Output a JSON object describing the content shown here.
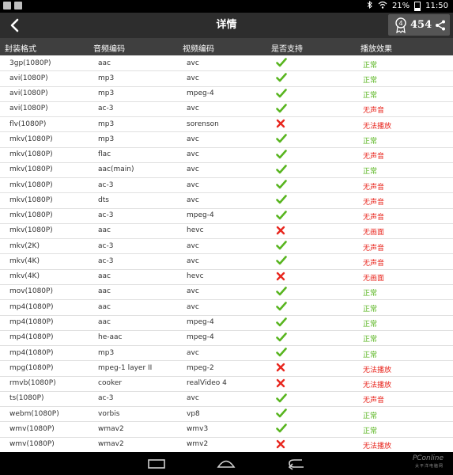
{
  "status_bar": {
    "battery": "21%",
    "time": "11:50"
  },
  "header": {
    "title": "详情",
    "badge_count": "454"
  },
  "table": {
    "columns": [
      "封装格式",
      "音频编码",
      "视频编码",
      "是否支持",
      "播放效果"
    ],
    "rows": [
      {
        "container": "3gp(1080P)",
        "audio": "aac",
        "video": "avc",
        "supported": true,
        "effect": "正常"
      },
      {
        "container": "avi(1080P)",
        "audio": "mp3",
        "video": "avc",
        "supported": true,
        "effect": "正常"
      },
      {
        "container": "avi(1080P)",
        "audio": "mp3",
        "video": "mpeg-4",
        "supported": true,
        "effect": "正常"
      },
      {
        "container": "avi(1080P)",
        "audio": "ac-3",
        "video": "avc",
        "supported": true,
        "effect": "无声音"
      },
      {
        "container": "flv(1080P)",
        "audio": "mp3",
        "video": "sorenson",
        "supported": false,
        "effect": "无法播放"
      },
      {
        "container": "mkv(1080P)",
        "audio": "mp3",
        "video": "avc",
        "supported": true,
        "effect": "正常"
      },
      {
        "container": "mkv(1080P)",
        "audio": "flac",
        "video": "avc",
        "supported": true,
        "effect": "无声音"
      },
      {
        "container": "mkv(1080P)",
        "audio": "aac(main)",
        "video": "avc",
        "supported": true,
        "effect": "正常"
      },
      {
        "container": "mkv(1080P)",
        "audio": "ac-3",
        "video": "avc",
        "supported": true,
        "effect": "无声音"
      },
      {
        "container": "mkv(1080P)",
        "audio": "dts",
        "video": "avc",
        "supported": true,
        "effect": "无声音"
      },
      {
        "container": "mkv(1080P)",
        "audio": "ac-3",
        "video": "mpeg-4",
        "supported": true,
        "effect": "无声音"
      },
      {
        "container": "mkv(1080P)",
        "audio": "aac",
        "video": "hevc",
        "supported": false,
        "effect": "无画面"
      },
      {
        "container": "mkv(2K)",
        "audio": "ac-3",
        "video": "avc",
        "supported": true,
        "effect": "无声音"
      },
      {
        "container": "mkv(4K)",
        "audio": "ac-3",
        "video": "avc",
        "supported": true,
        "effect": "无声音"
      },
      {
        "container": "mkv(4K)",
        "audio": "aac",
        "video": "hevc",
        "supported": false,
        "effect": "无画面"
      },
      {
        "container": "mov(1080P)",
        "audio": "aac",
        "video": "avc",
        "supported": true,
        "effect": "正常"
      },
      {
        "container": "mp4(1080P)",
        "audio": "aac",
        "video": "avc",
        "supported": true,
        "effect": "正常"
      },
      {
        "container": "mp4(1080P)",
        "audio": "aac",
        "video": "mpeg-4",
        "supported": true,
        "effect": "正常"
      },
      {
        "container": "mp4(1080P)",
        "audio": "he-aac",
        "video": "mpeg-4",
        "supported": true,
        "effect": "正常"
      },
      {
        "container": "mp4(1080P)",
        "audio": "mp3",
        "video": "avc",
        "supported": true,
        "effect": "正常"
      },
      {
        "container": "mpg(1080P)",
        "audio": "mpeg-1 layer II",
        "video": "mpeg-2",
        "supported": false,
        "effect": "无法播放"
      },
      {
        "container": "rmvb(1080P)",
        "audio": "cooker",
        "video": "realVideo 4",
        "supported": false,
        "effect": "无法播放"
      },
      {
        "container": "ts(1080P)",
        "audio": "ac-3",
        "video": "avc",
        "supported": true,
        "effect": "无声音"
      },
      {
        "container": "webm(1080P)",
        "audio": "vorbis",
        "video": "vp8",
        "supported": true,
        "effect": "正常"
      },
      {
        "container": "wmv(1080P)",
        "audio": "wmav2",
        "video": "wmv3",
        "supported": true,
        "effect": "正常"
      },
      {
        "container": "wmv(1080P)",
        "audio": "wmav2",
        "video": "wmv2",
        "supported": false,
        "effect": "无法播放"
      }
    ]
  },
  "watermark": {
    "brand": "PConline",
    "sub": "太平洋电脑网"
  },
  "colors": {
    "ok": "#58b51f",
    "bad": "#e8261e",
    "header_bg": "#3f3f3f",
    "titlebar_bg": "#2d2d2d"
  },
  "icons": {
    "supported": "check-icon",
    "unsupported": "cross-icon"
  }
}
